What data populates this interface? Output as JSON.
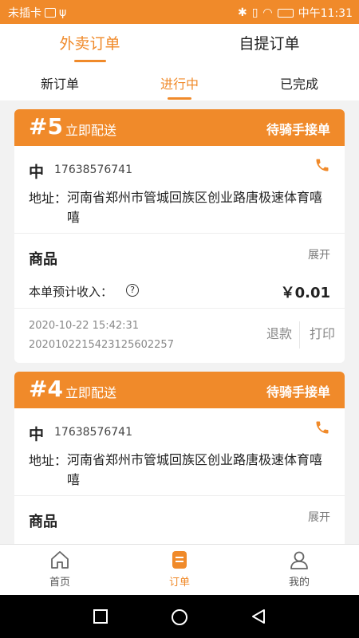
{
  "status_bar": {
    "carrier": "未插卡",
    "time": "中午11:31"
  },
  "main_tabs": [
    {
      "label": "外卖订单",
      "active": true
    },
    {
      "label": "自提订单",
      "active": false
    }
  ],
  "sub_tabs": [
    {
      "label": "新订单",
      "active": false
    },
    {
      "label": "进行中",
      "active": true
    },
    {
      "label": "已完成",
      "active": false
    }
  ],
  "orders": [
    {
      "number": "#5",
      "delivery_type": "立即配送",
      "status": "待骑手接单",
      "customer_name": "中",
      "phone": "17638576741",
      "address_label": "地址：",
      "address": "河南省郑州市管城回族区创业路唐极速体育嘻嘻",
      "goods_title": "商品",
      "expand_label": "展开",
      "income_label": "本单预计收入：",
      "income_value": "￥0.01",
      "time": "2020-10-22 15:42:31",
      "order_no": "2020102215423125602257",
      "refund_label": "退款",
      "print_label": "打印"
    },
    {
      "number": "#4",
      "delivery_type": "立即配送",
      "status": "待骑手接单",
      "customer_name": "中",
      "phone": "17638576741",
      "address_label": "地址：",
      "address": "河南省郑州市管城回族区创业路唐极速体育嘻嘻",
      "goods_title": "商品",
      "expand_label": "展开"
    }
  ],
  "bottom_nav": [
    {
      "label": "首页",
      "icon": "home-icon"
    },
    {
      "label": "订单",
      "icon": "order-icon",
      "active": true
    },
    {
      "label": "我的",
      "icon": "profile-icon"
    }
  ],
  "colors": {
    "accent": "#f08a2a"
  }
}
